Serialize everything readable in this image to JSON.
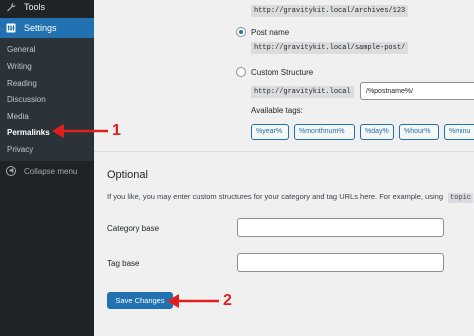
{
  "sidebar": {
    "tools_label": "Tools",
    "settings_label": "Settings",
    "items": [
      {
        "label": "General"
      },
      {
        "label": "Writing"
      },
      {
        "label": "Reading"
      },
      {
        "label": "Discussion"
      },
      {
        "label": "Media"
      },
      {
        "label": "Permalinks"
      },
      {
        "label": "Privacy"
      }
    ],
    "collapse_label": "Collapse menu"
  },
  "permalinks": {
    "archives_example": "http://gravitykit.local/archives/123",
    "post_name_label": "Post name",
    "post_name_example": "http://gravitykit.local/sample-post/",
    "custom_structure_label": "Custom Structure",
    "custom_base": "http://gravitykit.local",
    "custom_value": "/%postname%/",
    "available_tags_label": "Available tags:",
    "tags": [
      "%year%",
      "%monthnum%",
      "%day%",
      "%hour%",
      "%minu"
    ]
  },
  "optional": {
    "heading": "Optional",
    "help_text": "If you like, you may enter custom structures for your category and tag URLs here. For example, using",
    "help_code": "topic",
    "category_base_label": "Category base",
    "tag_base_label": "Tag base",
    "category_base_value": "",
    "tag_base_value": ""
  },
  "save_button_label": "Save Changes",
  "annotations": {
    "label_1": "1",
    "label_2": "2",
    "color": "#e0201f"
  }
}
